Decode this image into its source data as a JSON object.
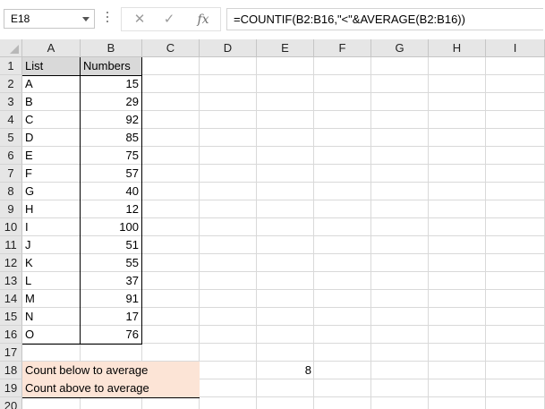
{
  "formula_bar": {
    "name_box": "E18",
    "cancel_glyph": "✕",
    "enter_glyph": "✓",
    "insert_function_label": "fx",
    "formula": "=COUNTIF(B2:B16,\"<\"&AVERAGE(B2:B16))"
  },
  "columns": [
    "A",
    "B",
    "C",
    "D",
    "E",
    "F",
    "G",
    "H",
    "I"
  ],
  "rows": [
    "1",
    "2",
    "3",
    "4",
    "5",
    "6",
    "7",
    "8",
    "9",
    "10",
    "11",
    "12",
    "13",
    "14",
    "15",
    "16",
    "17",
    "18",
    "19",
    "20"
  ],
  "table": {
    "header_list": "List",
    "header_numbers": "Numbers",
    "items": [
      {
        "label": "A",
        "value": "15"
      },
      {
        "label": "B",
        "value": "29"
      },
      {
        "label": "C",
        "value": "92"
      },
      {
        "label": "D",
        "value": "85"
      },
      {
        "label": "E",
        "value": "75"
      },
      {
        "label": "F",
        "value": "57"
      },
      {
        "label": "G",
        "value": "40"
      },
      {
        "label": "H",
        "value": "12"
      },
      {
        "label": "I",
        "value": "100"
      },
      {
        "label": "J",
        "value": "51"
      },
      {
        "label": "K",
        "value": "55"
      },
      {
        "label": "L",
        "value": "37"
      },
      {
        "label": "M",
        "value": "91"
      },
      {
        "label": "N",
        "value": "17"
      },
      {
        "label": "O",
        "value": "76"
      }
    ]
  },
  "summary": {
    "below_label": "Count below to average",
    "below_value": "8",
    "above_label": "Count above to average"
  },
  "colors": {
    "highlight_fill": "#fce4d6",
    "header_fill": "#d9d9d9"
  }
}
